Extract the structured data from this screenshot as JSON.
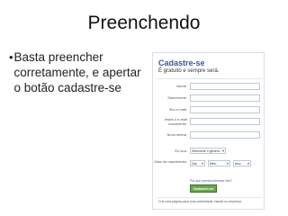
{
  "slide": {
    "title": "Preenchendo",
    "bullet_symbol": "•",
    "bullet": "Basta preencher corretamente, e apertar o botão cadastre-se"
  },
  "signup": {
    "heading": "Cadastre-se",
    "subheading": "É gratuito e sempre será.",
    "fields": [
      {
        "label": "Nome:"
      },
      {
        "label": "Sobrenome:"
      },
      {
        "label": "Seu e-mail:"
      },
      {
        "label": "Insira o e-mail novamente:"
      },
      {
        "label": "Nova senha:"
      }
    ],
    "sex_label": "Eu sou:",
    "sex_select": "Selecione o gênero:",
    "birthday_label": "Data de nascimento:",
    "day_select": "Dia:",
    "month_select": "Mês:",
    "year_select": "Ano:",
    "birthday_link": "Por que preciso informar isto?",
    "submit": "Cadastre-se",
    "footer": "Crie uma página para uma celebridade, banda ou empresa."
  }
}
